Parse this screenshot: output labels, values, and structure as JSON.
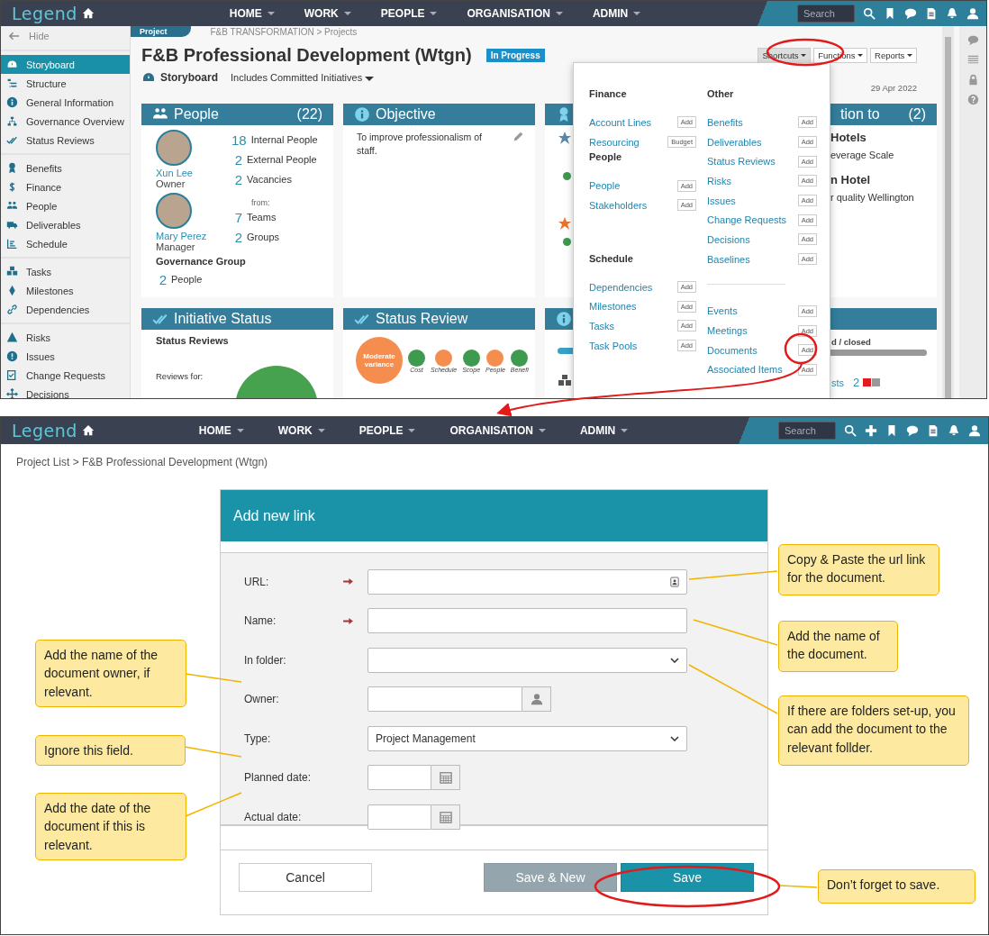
{
  "top_screen": {
    "header": {
      "logo": "Legend",
      "nav": [
        "HOME",
        "WORK",
        "PEOPLE",
        "ORGANISATION",
        "ADMIN"
      ],
      "search_placeholder": "Search"
    },
    "sidebar": {
      "hide": "Hide",
      "groups": [
        [
          {
            "label": "Storyboard",
            "selected": true
          },
          {
            "label": "Structure",
            "selected": false
          },
          {
            "label": "General Information",
            "selected": false
          },
          {
            "label": "Governance Overview",
            "selected": false
          },
          {
            "label": "Status Reviews",
            "selected": false
          }
        ],
        [
          {
            "label": "Benefits",
            "selected": false
          },
          {
            "label": "Finance",
            "selected": false
          },
          {
            "label": "People",
            "selected": false
          },
          {
            "label": "Deliverables",
            "selected": false
          },
          {
            "label": "Schedule",
            "selected": false
          }
        ],
        [
          {
            "label": "Tasks",
            "selected": false
          },
          {
            "label": "Milestones",
            "selected": false
          },
          {
            "label": "Dependencies",
            "selected": false
          }
        ],
        [
          {
            "label": "Risks",
            "selected": false
          },
          {
            "label": "Issues",
            "selected": false
          },
          {
            "label": "Change Requests",
            "selected": false
          },
          {
            "label": "Decisions",
            "selected": false
          }
        ]
      ]
    },
    "tab": "Project",
    "breadcrumb": "F&B TRANSFORMATION > Projects",
    "title": "F&B Professional Development (Wtgn)",
    "status_badge": "In Progress",
    "view": "Storyboard",
    "filter": "Includes Committed Initiatives",
    "buttons": [
      {
        "label": "Shortcuts",
        "selected": true
      },
      {
        "label": "Functions",
        "selected": false
      },
      {
        "label": "Reports",
        "selected": false
      }
    ],
    "date": "29 Apr 2022",
    "people_card": {
      "title": "People",
      "count": "(22)",
      "persons": [
        {
          "name": "Xun Lee",
          "role": "Owner"
        },
        {
          "name": "Mary Perez",
          "role": "Manager"
        }
      ],
      "stats": [
        {
          "value": "18",
          "label": "Internal People"
        },
        {
          "value": "2",
          "label": "External People"
        },
        {
          "value": "2",
          "label": "Vacancies"
        }
      ],
      "from": "from:",
      "groups": [
        {
          "value": "7",
          "label": "Teams"
        },
        {
          "value": "2",
          "label": "Groups"
        }
      ],
      "governance": "Governance Group",
      "governance_stat": {
        "value": "2",
        "label": "People"
      }
    },
    "objective_card": {
      "title": "Objective",
      "text": "To improve professionalism of staff."
    },
    "contribution_card": {
      "title": "tion to",
      "count": "(2)",
      "lines": [
        {
          "text": "Hotels",
          "bold": true
        },
        {
          "text": "everage Scale",
          "bold": false
        },
        {
          "text": "n Hotel",
          "bold": true
        },
        {
          "text": "r quality Wellington",
          "bold": false
        }
      ]
    },
    "initiative_card": {
      "title": "Initiative Status",
      "heading": "Status Reviews",
      "reviews_for": "Reviews for:"
    },
    "status_card": {
      "title": "Status Review",
      "overall": "Moderate variance",
      "dots": [
        {
          "label": "Cost",
          "color": "#3d9a4e"
        },
        {
          "label": "Schedule",
          "color": "#f58d4e"
        },
        {
          "label": "Scope",
          "color": "#3d9a4e"
        },
        {
          "label": "People",
          "color": "#f58d4e"
        },
        {
          "label": "Benefi",
          "color": "#3d9a4e"
        }
      ]
    },
    "info_card": {
      "closed_label": "d / closed",
      "closed_bar": {
        "level": 1
      },
      "list_label": "sts",
      "list_count": "2"
    },
    "shortcuts_menu": {
      "columns": [
        [
          {
            "heading": "Finance",
            "items": [
              {
                "label": "Account Lines",
                "action": "Add"
              },
              {
                "label": "Resourcing",
                "action": "Budget"
              }
            ]
          },
          {
            "heading": "People",
            "items": [
              {
                "label": "People",
                "action": "Add"
              },
              {
                "label": "Stakeholders",
                "action": "Add"
              }
            ]
          },
          {
            "heading": "Schedule",
            "items": [
              {
                "label": "Dependencies",
                "action": "Add"
              },
              {
                "label": "Milestones",
                "action": "Add"
              },
              {
                "label": "Tasks",
                "action": "Add"
              },
              {
                "label": "Task Pools",
                "action": "Add"
              }
            ]
          }
        ],
        [
          {
            "heading": "Other",
            "items": [
              {
                "label": "Benefits",
                "action": "Add"
              },
              {
                "label": "Deliverables",
                "action": "Add"
              },
              {
                "label": "Status Reviews",
                "action": "Add"
              },
              {
                "label": "Risks",
                "action": "Add"
              },
              {
                "label": "Issues",
                "action": "Add"
              },
              {
                "label": "Change Requests",
                "action": "Add"
              },
              {
                "label": "Decisions",
                "action": "Add"
              },
              {
                "label": "Baselines",
                "action": "Add"
              }
            ]
          },
          {
            "items": [
              {
                "label": "Events",
                "action": "Add"
              },
              {
                "label": "Meetings",
                "action": "Add"
              },
              {
                "label": "Documents",
                "action": "Add"
              },
              {
                "label": "Associated Items",
                "action": "Add"
              }
            ]
          }
        ]
      ]
    }
  },
  "bottom_screen": {
    "header": {
      "logo": "Legend",
      "nav": [
        "HOME",
        "WORK",
        "PEOPLE",
        "ORGANISATION",
        "ADMIN"
      ],
      "search_placeholder": "Search"
    },
    "breadcrumb": "Project List > F&B Professional Development (Wtgn)",
    "dialog": {
      "title": "Add new link",
      "fields": [
        {
          "label": "URL:",
          "kind": "url",
          "required": true
        },
        {
          "label": "Name:",
          "kind": "text",
          "required": true
        },
        {
          "label": "In folder:",
          "kind": "select",
          "required": false
        },
        {
          "label": "Owner:",
          "kind": "person",
          "required": false
        },
        {
          "label": "Type:",
          "kind": "select",
          "required": false,
          "value": "Project Management"
        },
        {
          "label": "Planned date:",
          "kind": "date",
          "required": false
        },
        {
          "label": "Actual date:",
          "kind": "date",
          "required": false
        }
      ],
      "cancel": "Cancel",
      "save_new": "Save & New",
      "save": "Save"
    },
    "callouts": [
      {
        "text": "Copy & Paste the url link for the document."
      },
      {
        "text": "Add the name of the document."
      },
      {
        "text": "If there are folders set-up, you can add the document to the relevant follder."
      },
      {
        "text": "Add the name of the document owner, if relevant."
      },
      {
        "text": "Ignore this field."
      },
      {
        "text": "Add the date of the document if this is relevant."
      },
      {
        "text": "Don’t forget to save."
      }
    ]
  }
}
